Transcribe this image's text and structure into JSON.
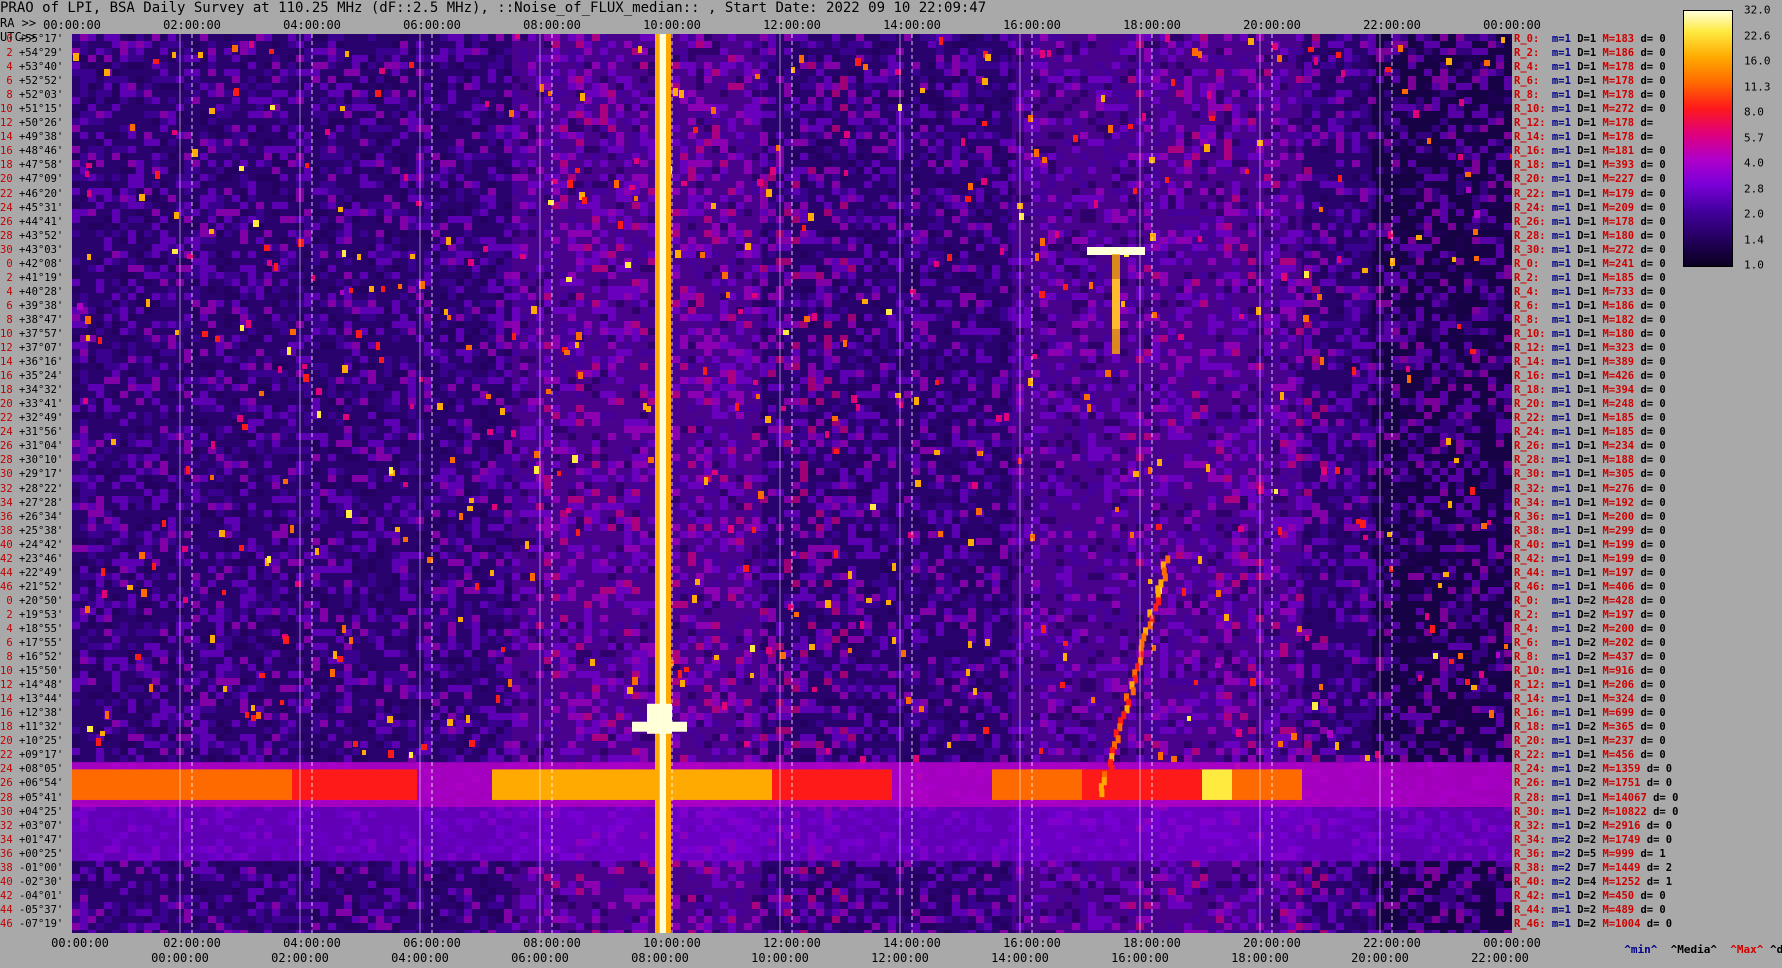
{
  "title": "PRAO of LPI, BSA Daily Survey at 110.25 MHz (dF::2.5 MHz), ::Noise_of_FLUX_median:: , Start Date: 2022 09 10 22:09:47",
  "chart_data": {
    "type": "heatmap",
    "title": "PRAO of LPI, BSA Daily Survey at 110.25 MHz (dF::2.5 MHz), ::Noise_of_FLUX_median:: , Start Date: 2022 09 10 22:09:47",
    "x_ticks_top": [
      "00:00:00",
      "02:00:00",
      "04:00:00",
      "06:00:00",
      "08:00:00",
      "10:00:00",
      "12:00:00",
      "14:00:00",
      "16:00:00",
      "18:00:00",
      "20:00:00",
      "22:00:00",
      "00:00:00"
    ],
    "x_ticks_ra_label": "RA >>",
    "x_ticks_ra": [
      "00:00:00",
      "02:00:00",
      "04:00:00",
      "06:00:00",
      "08:00:00",
      "10:00:00",
      "12:00:00",
      "14:00:00",
      "16:00:00",
      "18:00:00",
      "20:00:00",
      "22:00:00",
      "00:00:00"
    ],
    "x_ticks_utc_label": "UTC>>",
    "x_ticks_utc": [
      "00:00:00",
      "02:00:00",
      "04:00:00",
      "06:00:00",
      "08:00:00",
      "10:00:00",
      "12:00:00",
      "14:00:00",
      "16:00:00",
      "18:00:00",
      "20:00:00",
      "22:00:00"
    ],
    "y_labels": [
      {
        "idx": "0",
        "dec": "+55°17'"
      },
      {
        "idx": "2",
        "dec": "+54°29'"
      },
      {
        "idx": "4",
        "dec": "+53°40'"
      },
      {
        "idx": "6",
        "dec": "+52°52'"
      },
      {
        "idx": "8",
        "dec": "+52°03'"
      },
      {
        "idx": "10",
        "dec": "+51°15'"
      },
      {
        "idx": "12",
        "dec": "+50°26'"
      },
      {
        "idx": "14",
        "dec": "+49°38'"
      },
      {
        "idx": "16",
        "dec": "+48°46'"
      },
      {
        "idx": "18",
        "dec": "+47°58'"
      },
      {
        "idx": "20",
        "dec": "+47°09'"
      },
      {
        "idx": "22",
        "dec": "+46°20'"
      },
      {
        "idx": "24",
        "dec": "+45°31'"
      },
      {
        "idx": "26",
        "dec": "+44°41'"
      },
      {
        "idx": "28",
        "dec": "+43°52'"
      },
      {
        "idx": "30",
        "dec": "+43°03'"
      },
      {
        "idx": "0",
        "dec": "+42°08'"
      },
      {
        "idx": "2",
        "dec": "+41°19'"
      },
      {
        "idx": "4",
        "dec": "+40°28'"
      },
      {
        "idx": "6",
        "dec": "+39°38'"
      },
      {
        "idx": "8",
        "dec": "+38°47'"
      },
      {
        "idx": "10",
        "dec": "+37°57'"
      },
      {
        "idx": "12",
        "dec": "+37°07'"
      },
      {
        "idx": "14",
        "dec": "+36°16'"
      },
      {
        "idx": "16",
        "dec": "+35°24'"
      },
      {
        "idx": "18",
        "dec": "+34°32'"
      },
      {
        "idx": "20",
        "dec": "+33°41'"
      },
      {
        "idx": "22",
        "dec": "+32°49'"
      },
      {
        "idx": "24",
        "dec": "+31°56'"
      },
      {
        "idx": "26",
        "dec": "+31°04'"
      },
      {
        "idx": "28",
        "dec": "+30°10'"
      },
      {
        "idx": "30",
        "dec": "+29°17'"
      },
      {
        "idx": "32",
        "dec": "+28°22'"
      },
      {
        "idx": "34",
        "dec": "+27°28'"
      },
      {
        "idx": "36",
        "dec": "+26°34'"
      },
      {
        "idx": "38",
        "dec": "+25°38'"
      },
      {
        "idx": "40",
        "dec": "+24°42'"
      },
      {
        "idx": "42",
        "dec": "+23°46'"
      },
      {
        "idx": "44",
        "dec": "+22°49'"
      },
      {
        "idx": "46",
        "dec": "+21°52'"
      },
      {
        "idx": "0",
        "dec": "+20°50'"
      },
      {
        "idx": "2",
        "dec": "+19°53'"
      },
      {
        "idx": "4",
        "dec": "+18°55'"
      },
      {
        "idx": "6",
        "dec": "+17°55'"
      },
      {
        "idx": "8",
        "dec": "+16°52'"
      },
      {
        "idx": "10",
        "dec": "+15°50'"
      },
      {
        "idx": "12",
        "dec": "+14°48'"
      },
      {
        "idx": "14",
        "dec": "+13°44'"
      },
      {
        "idx": "16",
        "dec": "+12°38'"
      },
      {
        "idx": "18",
        "dec": "+11°32'"
      },
      {
        "idx": "20",
        "dec": "+10°25'"
      },
      {
        "idx": "22",
        "dec": "+09°17'"
      },
      {
        "idx": "24",
        "dec": "+08°05'"
      },
      {
        "idx": "26",
        "dec": "+06°54'"
      },
      {
        "idx": "28",
        "dec": "+05°41'"
      },
      {
        "idx": "30",
        "dec": "+04°25'"
      },
      {
        "idx": "32",
        "dec": "+03°07'"
      },
      {
        "idx": "34",
        "dec": "+01°47'"
      },
      {
        "idx": "36",
        "dec": "+00°25'"
      },
      {
        "idx": "38",
        "dec": "-01°00'"
      },
      {
        "idx": "40",
        "dec": "-02°30'"
      },
      {
        "idx": "42",
        "dec": "-04°01'"
      },
      {
        "idx": "44",
        "dec": "-05°37'"
      },
      {
        "idx": "46",
        "dec": "-07°19'"
      }
    ],
    "row_stats": [
      {
        "r": "R_0:",
        "m": "m=1",
        "D": "D=1",
        "M": "M=183",
        "d": "d= 0"
      },
      {
        "r": "R_2:",
        "m": "m=1",
        "D": "D=1",
        "M": "M=186",
        "d": "d= 0"
      },
      {
        "r": "R_4:",
        "m": "m=1",
        "D": "D=1",
        "M": "M=178",
        "d": "d= 0"
      },
      {
        "r": "R_6:",
        "m": "m=1",
        "D": "D=1",
        "M": "M=178",
        "d": "d= 0"
      },
      {
        "r": "R_8:",
        "m": "m=1",
        "D": "D=1",
        "M": "M=178",
        "d": "d= 0"
      },
      {
        "r": "R_10:",
        "m": "m=1",
        "D": "D=1",
        "M": "M=272",
        "d": "d= 0"
      },
      {
        "r": "R_12:",
        "m": "m=1",
        "D": "D=1",
        "M": "M=178",
        "d": "d="
      },
      {
        "r": "R_14:",
        "m": "m=1",
        "D": "D=1",
        "M": "M=178",
        "d": "d="
      },
      {
        "r": "R_16:",
        "m": "m=1",
        "D": "D=1",
        "M": "M=181",
        "d": "d= 0"
      },
      {
        "r": "R_18:",
        "m": "m=1",
        "D": "D=1",
        "M": "M=393",
        "d": "d= 0"
      },
      {
        "r": "R_20:",
        "m": "m=1",
        "D": "D=1",
        "M": "M=227",
        "d": "d= 0"
      },
      {
        "r": "R_22:",
        "m": "m=1",
        "D": "D=1",
        "M": "M=179",
        "d": "d= 0"
      },
      {
        "r": "R_24:",
        "m": "m=1",
        "D": "D=1",
        "M": "M=209",
        "d": "d= 0"
      },
      {
        "r": "R_26:",
        "m": "m=1",
        "D": "D=1",
        "M": "M=178",
        "d": "d= 0"
      },
      {
        "r": "R_28:",
        "m": "m=1",
        "D": "D=1",
        "M": "M=180",
        "d": "d= 0"
      },
      {
        "r": "R_30:",
        "m": "m=1",
        "D": "D=1",
        "M": "M=272",
        "d": "d= 0"
      },
      {
        "r": "R_0:",
        "m": "m=1",
        "D": "D=1",
        "M": "M=241",
        "d": "d= 0"
      },
      {
        "r": "R_2:",
        "m": "m=1",
        "D": "D=1",
        "M": "M=185",
        "d": "d= 0"
      },
      {
        "r": "R_4:",
        "m": "m=1",
        "D": "D=1",
        "M": "M=733",
        "d": "d= 0"
      },
      {
        "r": "R_6:",
        "m": "m=1",
        "D": "D=1",
        "M": "M=186",
        "d": "d= 0"
      },
      {
        "r": "R_8:",
        "m": "m=1",
        "D": "D=1",
        "M": "M=182",
        "d": "d= 0"
      },
      {
        "r": "R_10:",
        "m": "m=1",
        "D": "D=1",
        "M": "M=180",
        "d": "d= 0"
      },
      {
        "r": "R_12:",
        "m": "m=1",
        "D": "D=1",
        "M": "M=323",
        "d": "d= 0"
      },
      {
        "r": "R_14:",
        "m": "m=1",
        "D": "D=1",
        "M": "M=389",
        "d": "d= 0"
      },
      {
        "r": "R_16:",
        "m": "m=1",
        "D": "D=1",
        "M": "M=426",
        "d": "d= 0"
      },
      {
        "r": "R_18:",
        "m": "m=1",
        "D": "D=1",
        "M": "M=394",
        "d": "d= 0"
      },
      {
        "r": "R_20:",
        "m": "m=1",
        "D": "D=1",
        "M": "M=248",
        "d": "d= 0"
      },
      {
        "r": "R_22:",
        "m": "m=1",
        "D": "D=1",
        "M": "M=185",
        "d": "d= 0"
      },
      {
        "r": "R_24:",
        "m": "m=1",
        "D": "D=1",
        "M": "M=185",
        "d": "d= 0"
      },
      {
        "r": "R_26:",
        "m": "m=1",
        "D": "D=1",
        "M": "M=234",
        "d": "d= 0"
      },
      {
        "r": "R_28:",
        "m": "m=1",
        "D": "D=1",
        "M": "M=188",
        "d": "d= 0"
      },
      {
        "r": "R_30:",
        "m": "m=1",
        "D": "D=1",
        "M": "M=305",
        "d": "d= 0"
      },
      {
        "r": "R_32:",
        "m": "m=1",
        "D": "D=1",
        "M": "M=276",
        "d": "d= 0"
      },
      {
        "r": "R_34:",
        "m": "m=1",
        "D": "D=1",
        "M": "M=192",
        "d": "d= 0"
      },
      {
        "r": "R_36:",
        "m": "m=1",
        "D": "D=1",
        "M": "M=200",
        "d": "d= 0"
      },
      {
        "r": "R_38:",
        "m": "m=1",
        "D": "D=1",
        "M": "M=299",
        "d": "d= 0"
      },
      {
        "r": "R_40:",
        "m": "m=1",
        "D": "D=1",
        "M": "M=199",
        "d": "d= 0"
      },
      {
        "r": "R_42:",
        "m": "m=1",
        "D": "D=1",
        "M": "M=199",
        "d": "d= 0"
      },
      {
        "r": "R_44:",
        "m": "m=1",
        "D": "D=1",
        "M": "M=197",
        "d": "d= 0"
      },
      {
        "r": "R_46:",
        "m": "m=1",
        "D": "D=1",
        "M": "M=406",
        "d": "d= 0"
      },
      {
        "r": "R_0:",
        "m": "m=1",
        "D": "D=2",
        "M": "M=428",
        "d": "d= 0"
      },
      {
        "r": "R_2:",
        "m": "m=1",
        "D": "D=2",
        "M": "M=197",
        "d": "d= 0"
      },
      {
        "r": "R_4:",
        "m": "m=1",
        "D": "D=2",
        "M": "M=200",
        "d": "d= 0"
      },
      {
        "r": "R_6:",
        "m": "m=1",
        "D": "D=2",
        "M": "M=202",
        "d": "d= 0"
      },
      {
        "r": "R_8:",
        "m": "m=1",
        "D": "D=2",
        "M": "M=437",
        "d": "d= 0"
      },
      {
        "r": "R_10:",
        "m": "m=1",
        "D": "D=1",
        "M": "M=916",
        "d": "d= 0"
      },
      {
        "r": "R_12:",
        "m": "m=1",
        "D": "D=1",
        "M": "M=206",
        "d": "d= 0"
      },
      {
        "r": "R_14:",
        "m": "m=1",
        "D": "D=1",
        "M": "M=324",
        "d": "d= 0"
      },
      {
        "r": "R_16:",
        "m": "m=1",
        "D": "D=1",
        "M": "M=699",
        "d": "d= 0"
      },
      {
        "r": "R_18:",
        "m": "m=1",
        "D": "D=2",
        "M": "M=365",
        "d": "d= 0"
      },
      {
        "r": "R_20:",
        "m": "m=1",
        "D": "D=1",
        "M": "M=237",
        "d": "d= 0"
      },
      {
        "r": "R_22:",
        "m": "m=1",
        "D": "D=1",
        "M": "M=456",
        "d": "d= 0"
      },
      {
        "r": "R_24:",
        "m": "m=1",
        "D": "D=2",
        "M": "M=1359",
        "d": "d= 0"
      },
      {
        "r": "R_26:",
        "m": "m=1",
        "D": "D=2",
        "M": "M=1751",
        "d": "d= 0"
      },
      {
        "r": "R_28:",
        "m": "m=1",
        "D": "D=1",
        "M": "M=14067",
        "d": "d= 0"
      },
      {
        "r": "R_30:",
        "m": "m=1",
        "D": "D=2",
        "M": "M=10822",
        "d": "d= 0"
      },
      {
        "r": "R_32:",
        "m": "m=1",
        "D": "D=2",
        "M": "M=2916",
        "d": "d= 0"
      },
      {
        "r": "R_34:",
        "m": "m=2",
        "D": "D=2",
        "M": "M=1749",
        "d": "d= 0"
      },
      {
        "r": "R_36:",
        "m": "m=2",
        "D": "D=5",
        "M": "M=999",
        "d": "d= 1"
      },
      {
        "r": "R_38:",
        "m": "m=2",
        "D": "D=7",
        "M": "M=1449",
        "d": "d= 2"
      },
      {
        "r": "R_40:",
        "m": "m=2",
        "D": "D=4",
        "M": "M=1252",
        "d": "d= 1"
      },
      {
        "r": "R_42:",
        "m": "m=1",
        "D": "D=2",
        "M": "M=450",
        "d": "d= 0"
      },
      {
        "r": "R_44:",
        "m": "m=1",
        "D": "D=2",
        "M": "M=489",
        "d": "d= 0"
      },
      {
        "r": "R_46:",
        "m": "m=1",
        "D": "D=2",
        "M": "M=1004",
        "d": "d= 0"
      }
    ],
    "colorbar": [
      "32.0",
      "22.6",
      "16.0",
      "11.3",
      "8.0",
      "5.7",
      "4.0",
      "2.8",
      "2.0",
      "1.4",
      "1.0"
    ],
    "colorbar_colors": [
      "#0a0020",
      "#22005a",
      "#4400a0",
      "#7a00d8",
      "#b000c8",
      "#e0007a",
      "#ff1a1a",
      "#ff6a00",
      "#ffaa00",
      "#ffea40",
      "#ffffd8"
    ],
    "legend": {
      "min": "^min^",
      "median": "^Media^",
      "max": "^Max^",
      "dev": "^devia^"
    },
    "background_color": "#0d0630",
    "accent_color": "#d00000"
  }
}
